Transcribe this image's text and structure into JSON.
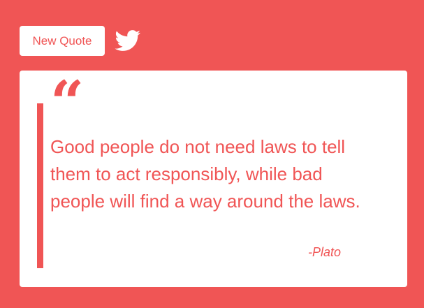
{
  "toolbar": {
    "new_quote_label": "New Quote",
    "tweet_icon": "twitter-icon"
  },
  "quote": {
    "mark": "“",
    "text": "Good people do not need laws to tell them to act responsibly, while bad people will find a way around the laws.",
    "author": "-Plato"
  },
  "colors": {
    "accent": "#f05555",
    "card_background": "#ffffff"
  }
}
